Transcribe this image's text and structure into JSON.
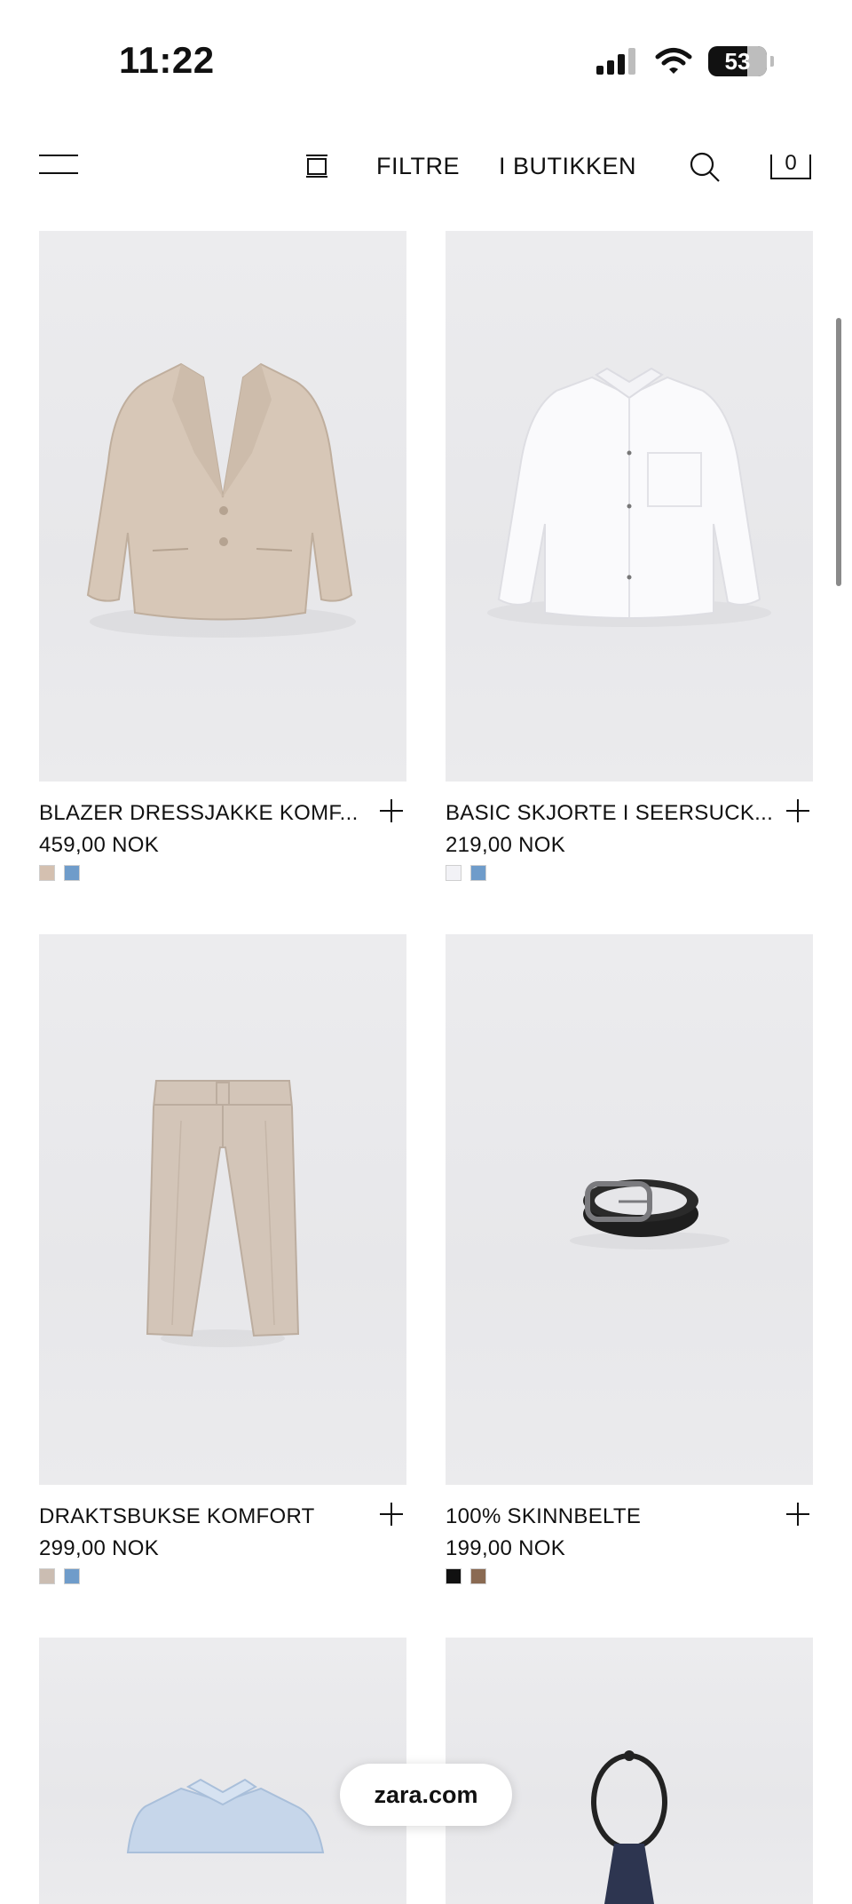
{
  "status_bar": {
    "time": "11:22",
    "battery": "53"
  },
  "nav": {
    "filters_label": "FILTRE",
    "in_store_label": "I BUTIKKEN",
    "cart_count": "0"
  },
  "products": [
    {
      "name": "BLAZER DRESSJAKKE KOMF...",
      "price": "459,00 NOK",
      "swatches": [
        "#d4c0b0",
        "#6f9cca"
      ]
    },
    {
      "name": "BASIC SKJORTE I SEERSUCK...",
      "price": "219,00 NOK",
      "swatches": [
        "#f2f2f6",
        "#6f9cca"
      ]
    },
    {
      "name": "DRAKTSBUKSE KOMFORT",
      "price": "299,00 NOK",
      "swatches": [
        "#cbbdb2",
        "#6f9cca"
      ]
    },
    {
      "name": "100% SKINNBELTE",
      "price": "199,00 NOK",
      "swatches": [
        "#111111",
        "#8a6a52"
      ]
    }
  ],
  "browser": {
    "url": "zara.com"
  }
}
